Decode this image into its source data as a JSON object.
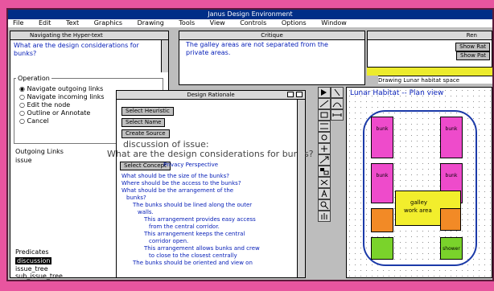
{
  "window_title": "Janus Design Environment",
  "menu": [
    "File",
    "Edit",
    "Text",
    "Graphics",
    "Drawing",
    "Tools",
    "View",
    "Controls",
    "Options",
    "Window"
  ],
  "navigator": {
    "title": "Navigating the Hyper-text",
    "question": "What are the design considerations for bunks?",
    "operation_label": "Operation",
    "operations": [
      "Navigate outgoing links",
      "Navigate incoming links",
      "Edit the node",
      "Outline or Annotate",
      "Cancel"
    ],
    "outgoing_label": "Outgoing Links",
    "outgoing_value": "issue",
    "predicates_label": "Predicates",
    "predicates": [
      "discussion",
      "issue_tree",
      "sub_issue_tree"
    ]
  },
  "critique": {
    "title": "Critique",
    "text": "The galley areas are not separated from the private areas."
  },
  "right_panel": {
    "title": "Ren",
    "buttons": [
      "Show Rat",
      "Show Pat"
    ]
  },
  "catalog_bar": "Drawing  Lunar habitat space",
  "rationale": {
    "title": "Design Rationale",
    "buttons": [
      "Select Heuristic",
      "Select Name",
      "Create Source"
    ],
    "overlay_line1": "discussion of issue:",
    "overlay_line2": "What are the design considerations for bunks?",
    "select_label": "Select Concept",
    "perspective": "Privacy Perspective",
    "lines": [
      "What should be the size of the bunks?",
      "Where should be the access to the bunks?",
      "What should be the arrangement of the",
      "bunks?",
      "The bunks should be lined along the outer",
      "walls.",
      "This arrangement provides easy access",
      "from the central corridor.",
      "This arrangement keeps the central",
      "corridor open.",
      "This arrangement allows bunks and crew",
      "to close to the closest centrally",
      "The bunks should be oriented and view on"
    ]
  },
  "plan": {
    "title": "Lunar Habitat -- Plan view",
    "bunk_label": "bunk",
    "galley_label": "galley",
    "work_label": "work area",
    "shower_label": "shower"
  },
  "colors": {
    "background": "#e8559f",
    "titlebar": "#002e87",
    "link_blue": "#0820b8",
    "bunk": "#ee4bcb",
    "galley": "#f2ee2c",
    "shower": "#7ad32b"
  }
}
